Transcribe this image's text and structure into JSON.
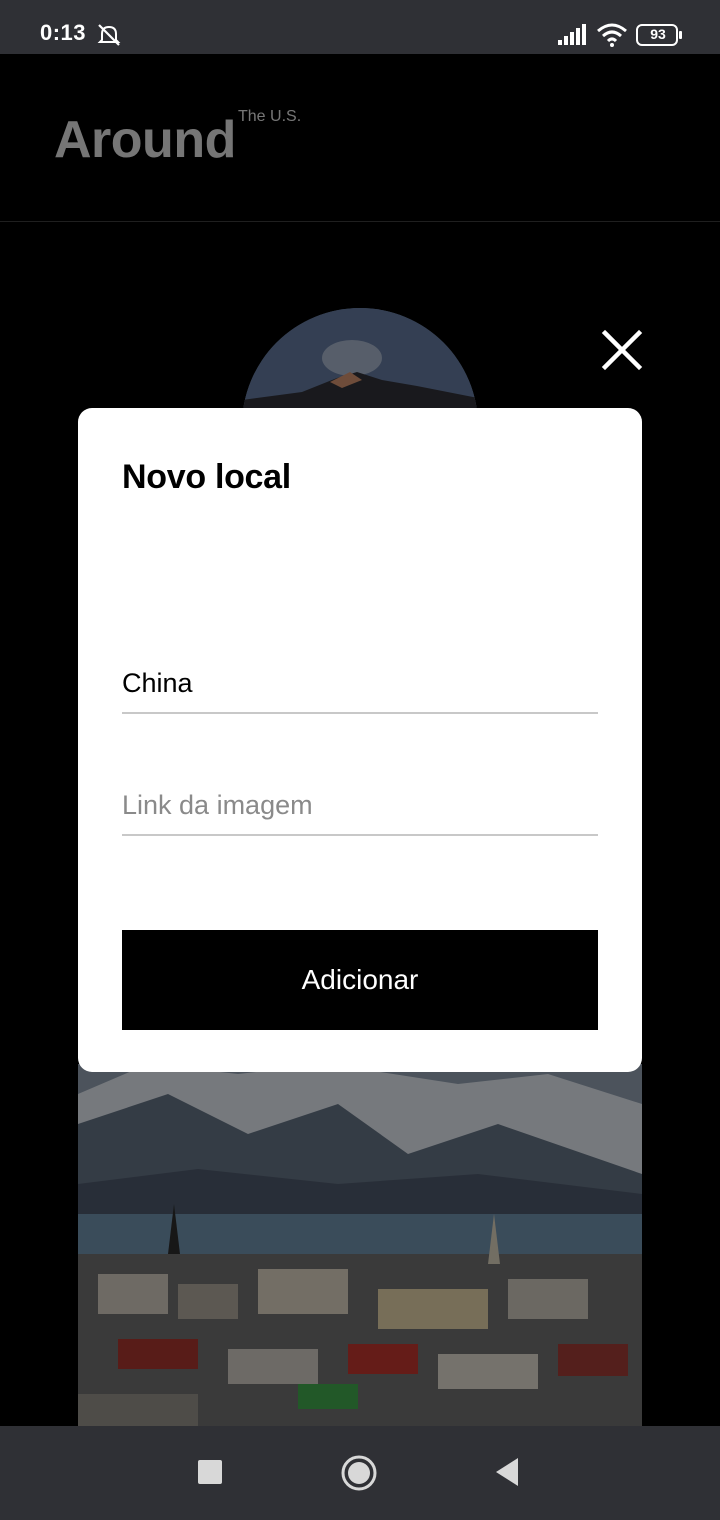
{
  "status_bar": {
    "time": "0:13",
    "battery": "93",
    "icons": [
      "dnd-icon",
      "signal-icon",
      "wifi-icon",
      "battery-icon"
    ]
  },
  "header": {
    "logo": "Around",
    "logo_sub": "The U.S."
  },
  "modal": {
    "title": "Novo local",
    "name_value": "China",
    "link_placeholder": "Link da imagem",
    "submit_label": "Adicionar",
    "close_icon": "close-icon"
  },
  "nav_bar": {
    "icons": [
      "recents-icon",
      "home-icon",
      "back-icon"
    ]
  },
  "colors": {
    "background": "#000000",
    "modal": "#ffffff",
    "button": "#000000",
    "system_bar": "#2f3035"
  }
}
